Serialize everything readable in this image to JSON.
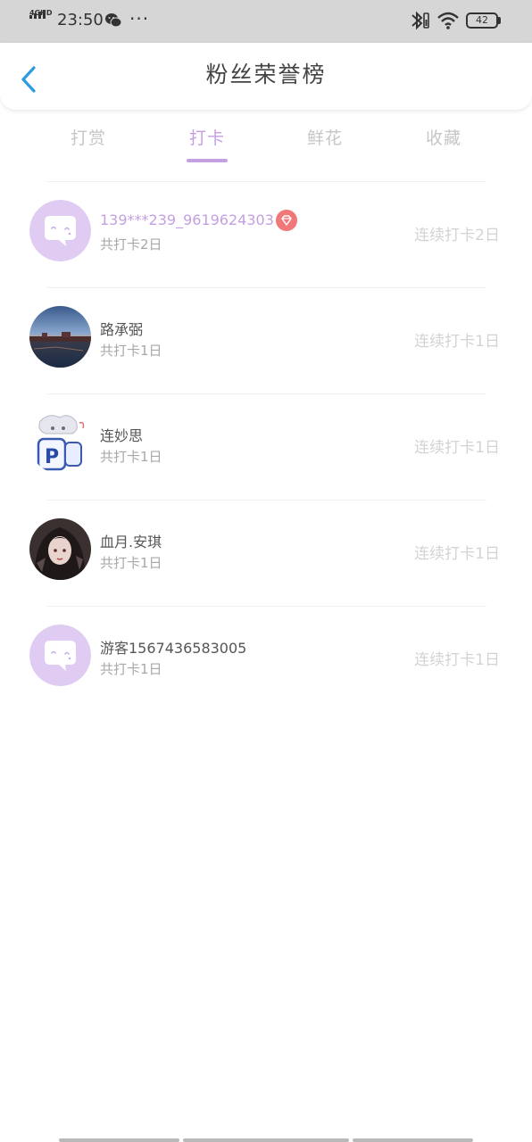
{
  "status_bar": {
    "network": "4GHD",
    "time": "23:50",
    "more": "···",
    "battery": "42",
    "icons": [
      "signal-icon",
      "wechat-icon",
      "bluetooth-icon",
      "wifi-icon",
      "battery-icon"
    ]
  },
  "header": {
    "title": "粉丝荣誉榜",
    "back_icon": "chevron-left-icon"
  },
  "tabs": [
    {
      "label": "打赏",
      "active": false
    },
    {
      "label": "打卡",
      "active": true
    },
    {
      "label": "鲜花",
      "active": false
    },
    {
      "label": "收藏",
      "active": false
    }
  ],
  "fans": [
    {
      "name": "139***239_9619624303",
      "total": "共打卡2日",
      "streak": "连续打卡2日",
      "vip": true,
      "avatar": "default-chat-avatar"
    },
    {
      "name": "路承弼",
      "total": "共打卡1日",
      "streak": "连续打卡1日",
      "vip": false,
      "avatar": "landscape-photo-avatar"
    },
    {
      "name": "连妙思",
      "total": "共打卡1日",
      "streak": "连续打卡1日",
      "vip": false,
      "avatar": "anime-character-avatar"
    },
    {
      "name": "血月.安琪",
      "total": "共打卡1日",
      "streak": "连续打卡1日",
      "vip": false,
      "avatar": "dark-hair-girl-avatar"
    },
    {
      "name": "游客1567436583005",
      "total": "共打卡1日",
      "streak": "连续打卡1日",
      "vip": false,
      "avatar": "default-chat-avatar"
    }
  ],
  "colors": {
    "accent": "#c4a0e1",
    "back_arrow": "#2d9be0",
    "vip_badge": "#f07878",
    "status_bar_bg": "#d6d6d6"
  }
}
